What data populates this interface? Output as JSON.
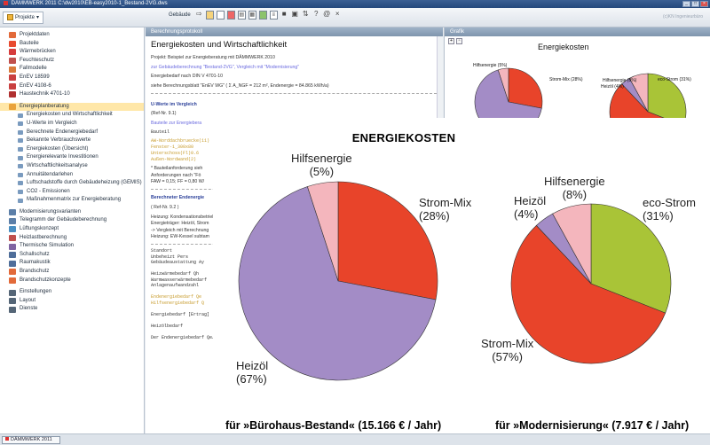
{
  "window": {
    "title": "DÄMMWERK 2011  C:\\dw2010\\EB-easy2010-1_Bestand-2VG.dws",
    "buttons": [
      "_",
      "□",
      "×"
    ]
  },
  "toolbar": {
    "project_label": "Projekte",
    "building_label": "Gebäude",
    "right_text": "(c)KN Ingenieurbüro",
    "icons": [
      "folder-open-icon",
      "page-icon",
      "pdf-icon",
      "print-icon",
      "page-settings-icon",
      "export-icon",
      "save-icon",
      "database-icon",
      "help-icon",
      "at-icon",
      "close-icon"
    ]
  },
  "tree": {
    "items": [
      {
        "label": "Projektdaten",
        "color": "#e26a3a",
        "sub": false
      },
      {
        "label": "Bauteile",
        "color": "#e84a2f",
        "sub": false
      },
      {
        "label": "Wärmebrücken",
        "color": "#d63d3d",
        "sub": false
      },
      {
        "label": "Feuchteschutz",
        "color": "#c0504d",
        "sub": false
      },
      {
        "label": "Fallmodelle",
        "color": "#d97a3a",
        "sub": false
      },
      {
        "label": "EnEV 18599",
        "color": "#c94040",
        "sub": false
      },
      {
        "label": "EnEV 4108-6",
        "color": "#c94040",
        "sub": false
      },
      {
        "label": "Haustechnik 4701-10",
        "color": "#b03030",
        "sub": false
      },
      {
        "label": "Energieplanberatung",
        "color": "#e9a23b",
        "sub": false,
        "selected": true
      },
      {
        "label": "Energiekosten und Wirtschaftlichkeit",
        "color": "#7a9bbf",
        "sub": true
      },
      {
        "label": "U-Werte im Vergleich",
        "color": "#7a9bbf",
        "sub": true
      },
      {
        "label": "Berechnete Endenergiebedarf",
        "color": "#7a9bbf",
        "sub": true
      },
      {
        "label": "Bekannte Verbrauchswerte",
        "color": "#7a9bbf",
        "sub": true
      },
      {
        "label": "Energiekosten (Übersicht)",
        "color": "#7a9bbf",
        "sub": true
      },
      {
        "label": "Energierelevante Investitionen",
        "color": "#7a9bbf",
        "sub": true
      },
      {
        "label": "Wirtschaftlichkeitsanalyse",
        "color": "#7a9bbf",
        "sub": true
      },
      {
        "label": "Annuitätendarlehen",
        "color": "#7a9bbf",
        "sub": true
      },
      {
        "label": "Luftschadstoffe durch Gebäudeheizung (GEMIS)",
        "color": "#7a9bbf",
        "sub": true
      },
      {
        "label": "CO2 - Emissionen",
        "color": "#7a9bbf",
        "sub": true
      },
      {
        "label": "Maßnahmenmatrix zur Energieberatung",
        "color": "#7a9bbf",
        "sub": true
      },
      {
        "label": "Modernisierungsvarianten",
        "color": "#5c7fa8",
        "sub": false
      },
      {
        "label": "Telegramm der Gebäudeberechnung",
        "color": "#5c7fa8",
        "sub": false
      },
      {
        "label": "Lüftungskonzept",
        "color": "#4a8fc2",
        "sub": false
      },
      {
        "label": "Heizlastberechnung",
        "color": "#c0504d",
        "sub": false
      },
      {
        "label": "Thermische Simulation",
        "color": "#8064a2",
        "sub": false
      },
      {
        "label": "Schallschutz",
        "color": "#4f6e9a",
        "sub": false
      },
      {
        "label": "Raumakustik",
        "color": "#4f6e9a",
        "sub": false
      },
      {
        "label": "Brandschutz",
        "color": "#e26a3a",
        "sub": false
      },
      {
        "label": "Brandschutzkonzepte",
        "color": "#e26a3a",
        "sub": false
      },
      {
        "label": "Einstellungen",
        "color": "#556677",
        "sub": false
      },
      {
        "label": "Layout",
        "color": "#556677",
        "sub": false
      },
      {
        "label": "Dienste",
        "color": "#556677",
        "sub": false
      }
    ]
  },
  "protocol": {
    "header": "Berechnungsprotokoll",
    "title": "Energiekosten und Wirtschaftlichkeit",
    "project_line": "Projekt: Beispiel zur Energieberatung mit DÄMMWERK 2010",
    "building_line": "zur Gebäudeberechnung \"Bestand-2VG\", Vergleich mit \"Modernisierung\"",
    "demand_line1": "Energiebedarf nach DIN V 4701-10",
    "demand_line2": "siehe Berechnungsblatt \"EnEV WG\" ( Σ A_NGF = 212 m², Endenergie = 84.865 kWh/a)",
    "uwerte_head": "U-Werte im Vergleich",
    "uwerte_ref": "(Ref-Nr. 9.1)",
    "bauteile_line": "Bauteile zur Energiebera",
    "bauteil_col": "Bauteil",
    "code_lines": [
      "AW-Norddachbruecke(11)",
      "Fenster-1_300x80",
      "Unterschoss(Fl)0.6",
      "Außen-Nordwand(2)"
    ],
    "note1": "* Bauteilanforderung sieh",
    "note2": "Anforderungen nach \"Fö",
    "note3": "FAW = 0,15; FF = 0,80 W/",
    "endenergie_head": "Berechneter Endenergie",
    "endenergie_ref": "( Ref-Nr. 9.2 )",
    "heizung_lines": [
      "Heizung: Kondensationsbetrieb",
      "Energieträger: Heizöl, Strom",
      "-> Vergleich mit Berechnung",
      "Heizung: EW-Kessel subtam"
    ],
    "table_lines": [
      "Standort",
      "Unbeheizt  Pers",
      "Gebäudeaustattung  Ay",
      "",
      "Heizwärmebedarf  Qh",
      "Warmwasserwärmebedarf",
      "Anlagenaufwandzahl",
      "",
      "Endenergiebedarf  Qe",
      "Hilfsenergiebedarf  Q",
      "",
      "Energiebedarf [Ertrag]",
      "",
      "Heizölbedarf",
      "",
      "Der Endenergiebedarf Qe/g"
    ]
  },
  "grafik": {
    "header": "Grafik",
    "title": "Energiekosten",
    "labels": {
      "hilf1": "Hilfsenergie (5%)",
      "strom1": "Strom-Mix (28%)",
      "hilf2": "Hilfsenergie (8%)",
      "heiz2": "Heizöl (4%)",
      "eco2": "eco-Strom (31%)"
    }
  },
  "status": {
    "task_label": "DÄMMWERK 2011"
  },
  "overlay": {
    "title": "ENERGIEKOSTEN",
    "caption_left": "für »Bürohaus-Bestand« (15.166 € / Jahr)",
    "caption_right": "für »Modernisierung« (7.917 € / Jahr)"
  },
  "chart_data": [
    {
      "type": "pie",
      "title": "ENERGIEKOSTEN",
      "caption": "für »Bürohaus-Bestand« (15.166 € / Jahr)",
      "slices": [
        {
          "label": "Strom-Mix",
          "percent_text": "(28%)",
          "value": 28,
          "color": "#e8442a"
        },
        {
          "label": "Heizöl",
          "percent_text": "(67%)",
          "value": 67,
          "color": "#a38cc6"
        },
        {
          "label": "Hilfsenergie",
          "percent_text": "(5%)",
          "value": 5,
          "color": "#f4b6bd"
        }
      ]
    },
    {
      "type": "pie",
      "title": "ENERGIEKOSTEN",
      "caption": "für »Modernisierung« (7.917 € / Jahr)",
      "slices": [
        {
          "label": "eco-Strom",
          "percent_text": "(31%)",
          "value": 31,
          "color": "#a9c437"
        },
        {
          "label": "Strom-Mix",
          "percent_text": "(57%)",
          "value": 57,
          "color": "#e8442a"
        },
        {
          "label": "Heizöl",
          "percent_text": "(4%)",
          "value": 4,
          "color": "#a38cc6"
        },
        {
          "label": "Hilfsenergie",
          "percent_text": "(8%)",
          "value": 8,
          "color": "#f4b6bd"
        }
      ]
    }
  ]
}
